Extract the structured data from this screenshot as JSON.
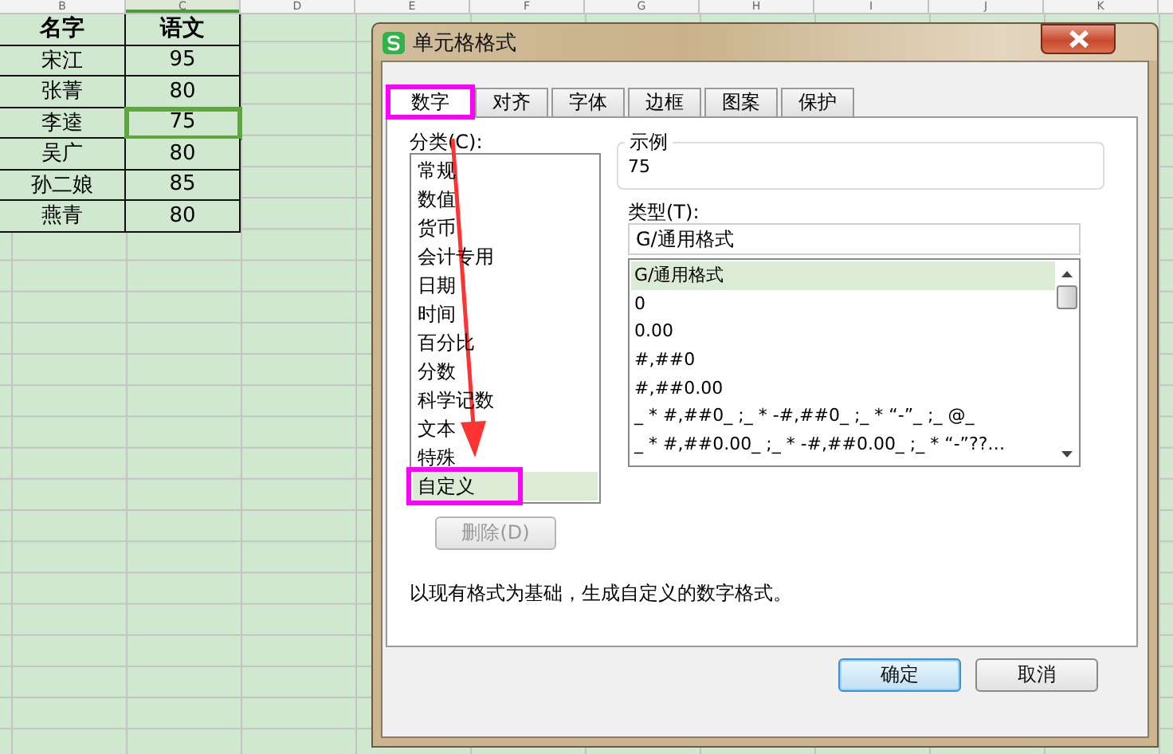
{
  "sheet": {
    "column_headers": [
      "B",
      "C",
      "D",
      "E",
      "F",
      "G",
      "H",
      "I",
      "J",
      "K"
    ],
    "header_row": [
      "名字",
      "语文"
    ],
    "rows": [
      {
        "cells": [
          "宋江",
          "95"
        ],
        "selected": false
      },
      {
        "cells": [
          "张菁",
          "80"
        ],
        "selected": false
      },
      {
        "cells": [
          "李逵",
          "75"
        ],
        "selected": true
      },
      {
        "cells": [
          "吴广",
          "80"
        ],
        "selected": false
      },
      {
        "cells": [
          "孙二娘",
          "85"
        ],
        "selected": false
      },
      {
        "cells": [
          "燕青",
          "80"
        ],
        "selected": false
      }
    ]
  },
  "dialog": {
    "title": "单元格格式",
    "tabs": [
      {
        "label": "数字",
        "selected": true,
        "highlighted": true
      },
      {
        "label": "对齐",
        "selected": false,
        "highlighted": false
      },
      {
        "label": "字体",
        "selected": false,
        "highlighted": false
      },
      {
        "label": "边框",
        "selected": false,
        "highlighted": false
      },
      {
        "label": "图案",
        "selected": false,
        "highlighted": false
      },
      {
        "label": "保护",
        "selected": false,
        "highlighted": false
      }
    ],
    "category_label": "分类(C):",
    "categories": [
      {
        "label": "常规",
        "selected": false,
        "highlighted": false
      },
      {
        "label": "数值",
        "selected": false,
        "highlighted": false
      },
      {
        "label": "货币",
        "selected": false,
        "highlighted": false
      },
      {
        "label": "会计专用",
        "selected": false,
        "highlighted": false
      },
      {
        "label": "日期",
        "selected": false,
        "highlighted": false
      },
      {
        "label": "时间",
        "selected": false,
        "highlighted": false
      },
      {
        "label": "百分比",
        "selected": false,
        "highlighted": false
      },
      {
        "label": "分数",
        "selected": false,
        "highlighted": false
      },
      {
        "label": "科学记数",
        "selected": false,
        "highlighted": false
      },
      {
        "label": "文本",
        "selected": false,
        "highlighted": false
      },
      {
        "label": "特殊",
        "selected": false,
        "highlighted": false
      },
      {
        "label": "自定义",
        "selected": true,
        "highlighted": true
      }
    ],
    "delete_button": {
      "label": "删除(D)",
      "disabled": true
    },
    "sample": {
      "label": "示例",
      "value": "75"
    },
    "type_label": "类型(T):",
    "type_field": {
      "value": "G/通用格式"
    },
    "type_options": [
      {
        "label": "G/通用格式",
        "selected": true
      },
      {
        "label": "0",
        "selected": false
      },
      {
        "label": "0.00",
        "selected": false
      },
      {
        "label": "#,##0",
        "selected": false
      },
      {
        "label": "#,##0.00",
        "selected": false
      },
      {
        "label": "_ * #,##0_ ;_ * -#,##0_ ;_ * “-”_ ;_ @_",
        "selected": false
      },
      {
        "label": "_ * #,##0.00_ ;_ * -#,##0.00_ ;_ * “-”??…",
        "selected": false
      }
    ],
    "description": "以现有格式为基础，生成自定义的数字格式。",
    "buttons": [
      {
        "label": "确定",
        "kind": "default"
      },
      {
        "label": "取消",
        "kind": "normal"
      }
    ]
  },
  "annotations": [
    {
      "kind": "arrow",
      "color": "#ff3333"
    }
  ]
}
